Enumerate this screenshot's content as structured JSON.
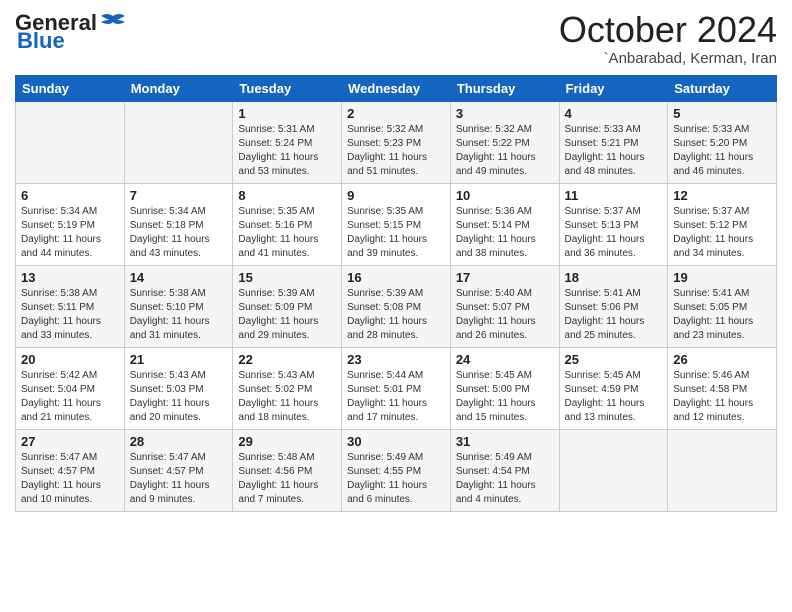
{
  "logo": {
    "line1": "General",
    "line2": "Blue"
  },
  "title": "October 2024",
  "subtitle": "`Anbarabad, Kerman, Iran",
  "days_of_week": [
    "Sunday",
    "Monday",
    "Tuesday",
    "Wednesday",
    "Thursday",
    "Friday",
    "Saturday"
  ],
  "weeks": [
    [
      {
        "day": "",
        "text": ""
      },
      {
        "day": "",
        "text": ""
      },
      {
        "day": "1",
        "text": "Sunrise: 5:31 AM\nSunset: 5:24 PM\nDaylight: 11 hours\nand 53 minutes."
      },
      {
        "day": "2",
        "text": "Sunrise: 5:32 AM\nSunset: 5:23 PM\nDaylight: 11 hours\nand 51 minutes."
      },
      {
        "day": "3",
        "text": "Sunrise: 5:32 AM\nSunset: 5:22 PM\nDaylight: 11 hours\nand 49 minutes."
      },
      {
        "day": "4",
        "text": "Sunrise: 5:33 AM\nSunset: 5:21 PM\nDaylight: 11 hours\nand 48 minutes."
      },
      {
        "day": "5",
        "text": "Sunrise: 5:33 AM\nSunset: 5:20 PM\nDaylight: 11 hours\nand 46 minutes."
      }
    ],
    [
      {
        "day": "6",
        "text": "Sunrise: 5:34 AM\nSunset: 5:19 PM\nDaylight: 11 hours\nand 44 minutes."
      },
      {
        "day": "7",
        "text": "Sunrise: 5:34 AM\nSunset: 5:18 PM\nDaylight: 11 hours\nand 43 minutes."
      },
      {
        "day": "8",
        "text": "Sunrise: 5:35 AM\nSunset: 5:16 PM\nDaylight: 11 hours\nand 41 minutes."
      },
      {
        "day": "9",
        "text": "Sunrise: 5:35 AM\nSunset: 5:15 PM\nDaylight: 11 hours\nand 39 minutes."
      },
      {
        "day": "10",
        "text": "Sunrise: 5:36 AM\nSunset: 5:14 PM\nDaylight: 11 hours\nand 38 minutes."
      },
      {
        "day": "11",
        "text": "Sunrise: 5:37 AM\nSunset: 5:13 PM\nDaylight: 11 hours\nand 36 minutes."
      },
      {
        "day": "12",
        "text": "Sunrise: 5:37 AM\nSunset: 5:12 PM\nDaylight: 11 hours\nand 34 minutes."
      }
    ],
    [
      {
        "day": "13",
        "text": "Sunrise: 5:38 AM\nSunset: 5:11 PM\nDaylight: 11 hours\nand 33 minutes."
      },
      {
        "day": "14",
        "text": "Sunrise: 5:38 AM\nSunset: 5:10 PM\nDaylight: 11 hours\nand 31 minutes."
      },
      {
        "day": "15",
        "text": "Sunrise: 5:39 AM\nSunset: 5:09 PM\nDaylight: 11 hours\nand 29 minutes."
      },
      {
        "day": "16",
        "text": "Sunrise: 5:39 AM\nSunset: 5:08 PM\nDaylight: 11 hours\nand 28 minutes."
      },
      {
        "day": "17",
        "text": "Sunrise: 5:40 AM\nSunset: 5:07 PM\nDaylight: 11 hours\nand 26 minutes."
      },
      {
        "day": "18",
        "text": "Sunrise: 5:41 AM\nSunset: 5:06 PM\nDaylight: 11 hours\nand 25 minutes."
      },
      {
        "day": "19",
        "text": "Sunrise: 5:41 AM\nSunset: 5:05 PM\nDaylight: 11 hours\nand 23 minutes."
      }
    ],
    [
      {
        "day": "20",
        "text": "Sunrise: 5:42 AM\nSunset: 5:04 PM\nDaylight: 11 hours\nand 21 minutes."
      },
      {
        "day": "21",
        "text": "Sunrise: 5:43 AM\nSunset: 5:03 PM\nDaylight: 11 hours\nand 20 minutes."
      },
      {
        "day": "22",
        "text": "Sunrise: 5:43 AM\nSunset: 5:02 PM\nDaylight: 11 hours\nand 18 minutes."
      },
      {
        "day": "23",
        "text": "Sunrise: 5:44 AM\nSunset: 5:01 PM\nDaylight: 11 hours\nand 17 minutes."
      },
      {
        "day": "24",
        "text": "Sunrise: 5:45 AM\nSunset: 5:00 PM\nDaylight: 11 hours\nand 15 minutes."
      },
      {
        "day": "25",
        "text": "Sunrise: 5:45 AM\nSunset: 4:59 PM\nDaylight: 11 hours\nand 13 minutes."
      },
      {
        "day": "26",
        "text": "Sunrise: 5:46 AM\nSunset: 4:58 PM\nDaylight: 11 hours\nand 12 minutes."
      }
    ],
    [
      {
        "day": "27",
        "text": "Sunrise: 5:47 AM\nSunset: 4:57 PM\nDaylight: 11 hours\nand 10 minutes."
      },
      {
        "day": "28",
        "text": "Sunrise: 5:47 AM\nSunset: 4:57 PM\nDaylight: 11 hours\nand 9 minutes."
      },
      {
        "day": "29",
        "text": "Sunrise: 5:48 AM\nSunset: 4:56 PM\nDaylight: 11 hours\nand 7 minutes."
      },
      {
        "day": "30",
        "text": "Sunrise: 5:49 AM\nSunset: 4:55 PM\nDaylight: 11 hours\nand 6 minutes."
      },
      {
        "day": "31",
        "text": "Sunrise: 5:49 AM\nSunset: 4:54 PM\nDaylight: 11 hours\nand 4 minutes."
      },
      {
        "day": "",
        "text": ""
      },
      {
        "day": "",
        "text": ""
      }
    ]
  ]
}
